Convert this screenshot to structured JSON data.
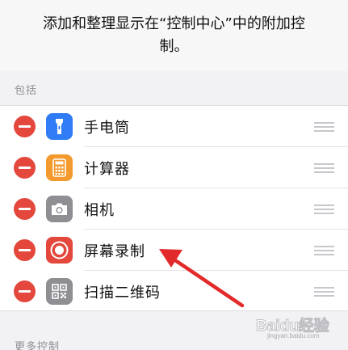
{
  "description": "添加和整理显示在“控制中心”中的附加控制。",
  "included_header": "包括",
  "more_header": "更多控制",
  "items": [
    {
      "label": "手电筒",
      "icon": "flashlight-icon",
      "color": "#2f7cf6"
    },
    {
      "label": "计算器",
      "icon": "calculator-icon",
      "color": "#f39a2e"
    },
    {
      "label": "相机",
      "icon": "camera-icon",
      "color": "#8e8e93"
    },
    {
      "label": "屏幕录制",
      "icon": "screen-record-icon",
      "color": "#e4473c"
    },
    {
      "label": "扫描二维码",
      "icon": "qr-code-icon",
      "color": "#8e8e93"
    }
  ],
  "colors": {
    "delete": "#e4473c",
    "arrow": "#e32a2a"
  },
  "watermark": {
    "text": "Baidu经验",
    "sub": "jingyan.baidu.com"
  }
}
